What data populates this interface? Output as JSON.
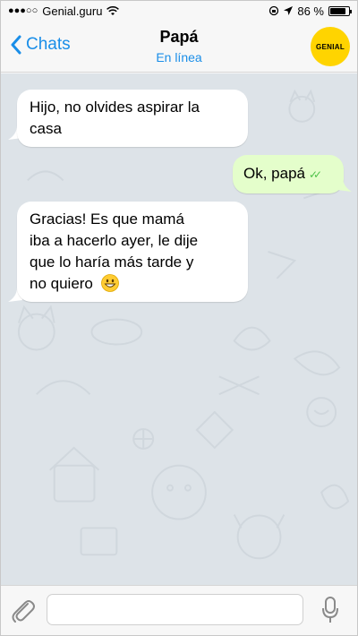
{
  "status": {
    "carrier": "Genial.guru",
    "signal": "●●●○○",
    "battery_text": "86 %",
    "battery_level": 0.86
  },
  "nav": {
    "back_label": "Chats",
    "title": "Papá",
    "subtitle": "En línea",
    "avatar_text": "GENIAL"
  },
  "messages": [
    {
      "side": "in",
      "lines": [
        "Hijo, no olvides aspirar la",
        "casa"
      ]
    },
    {
      "side": "out",
      "text": "Ok, papá",
      "checks": "✓✓"
    },
    {
      "side": "in",
      "lines": [
        "Gracias! Es que mamá",
        "iba a hacerlo ayer, le dije",
        "que lo haría más tarde y",
        "no quiero"
      ],
      "emoji": "grinning-face"
    }
  ],
  "colors": {
    "accent": "#1a8ee8",
    "outgoing_bubble": "#e4fecb",
    "incoming_bubble": "#ffffff",
    "chat_background": "#dde3e8",
    "avatar": "#ffd400",
    "read_checks": "#4fc24a"
  },
  "input": {
    "placeholder": ""
  }
}
